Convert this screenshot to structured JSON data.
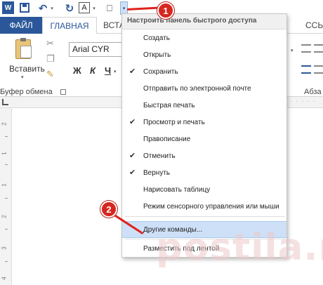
{
  "quick_access": {
    "font_icon_letter": "A",
    "dropdown_arrow": "▾"
  },
  "tabs": {
    "file": "ФАЙЛ",
    "home": "ГЛАВНАЯ",
    "insert": "ВСТА",
    "links": "ССЬ"
  },
  "ribbon": {
    "paste_label": "Вставить",
    "font_name": "Arial CYR",
    "bold": "Ж",
    "italic": "К",
    "underline": "Ч",
    "clipboard_group": "Буфер обмена",
    "paragraph_group": "Абза"
  },
  "menu": {
    "title": "Настроить панель быстрого доступа",
    "items": [
      {
        "label": "Создать",
        "checked": false
      },
      {
        "label": "Открыть",
        "checked": false
      },
      {
        "label": "Сохранить",
        "checked": true
      },
      {
        "label": "Отправить по электронной почте",
        "checked": false
      },
      {
        "label": "Быстрая печать",
        "checked": false
      },
      {
        "label": "Просмотр и печать",
        "checked": true
      },
      {
        "label": "Правописание",
        "checked": false
      },
      {
        "label": "Отменить",
        "checked": true
      },
      {
        "label": "Вернуть",
        "checked": true
      },
      {
        "label": "Нарисовать таблицу",
        "checked": false
      },
      {
        "label": "Режим сенсорного управления или мыши",
        "checked": false
      },
      {
        "label": "Другие команды...",
        "checked": false,
        "highlighted": true
      },
      {
        "label": "Разместить под лентой",
        "checked": false
      }
    ]
  },
  "ruler": {
    "vertical_numbers": [
      "2",
      "1",
      "1",
      "2",
      "3",
      "4"
    ]
  },
  "callouts": {
    "first": "1",
    "second": "2"
  },
  "watermark": "postila.ru",
  "colors": {
    "accent": "#2b579a",
    "callout": "#d7261f",
    "menu_highlight": "#cde0f7"
  }
}
